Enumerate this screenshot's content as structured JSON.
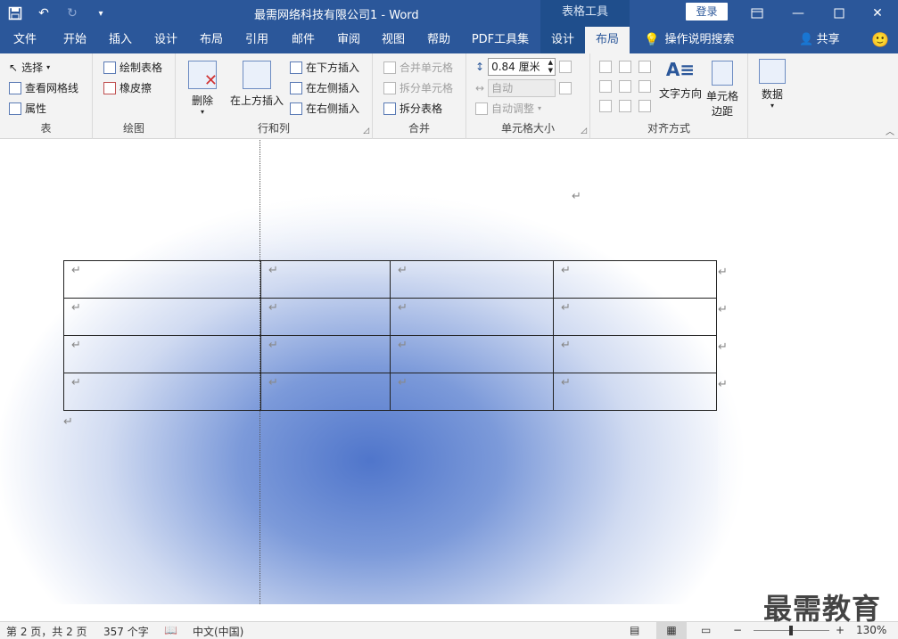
{
  "titlebar": {
    "doc_title": "最需网络科技有限公司1 - Word",
    "context_group": "表格工具",
    "login": "登录"
  },
  "tabs": [
    "文件",
    "开始",
    "插入",
    "设计",
    "布局",
    "引用",
    "邮件",
    "审阅",
    "视图",
    "帮助",
    "PDF工具集",
    "设计",
    "布局"
  ],
  "tell_me": "操作说明搜索",
  "share": "共享",
  "ribbon": {
    "table_group": {
      "label": "表",
      "select": "选择",
      "gridlines": "查看网格线",
      "properties": "属性"
    },
    "draw_group": {
      "label": "绘图",
      "draw_table": "绘制表格",
      "eraser": "橡皮擦"
    },
    "rows_cols": {
      "label": "行和列",
      "delete": "删除",
      "insert_above": "在上方插入",
      "insert_below": "在下方插入",
      "insert_left": "在左侧插入",
      "insert_right": "在右侧插入"
    },
    "merge": {
      "label": "合并",
      "merge_cells": "合并单元格",
      "split_cells": "拆分单元格",
      "split_table": "拆分表格"
    },
    "cell_size": {
      "label": "单元格大小",
      "height_value": "0.84 厘米",
      "width_value": "自动",
      "autofit": "自动调整"
    },
    "alignment": {
      "label": "对齐方式",
      "text_direction": "文字方向",
      "cell_margins_line1": "单元格",
      "cell_margins_line2": "边距"
    },
    "data": {
      "label": "数据"
    }
  },
  "document": {
    "para_mark": "↵",
    "table_rows": 4,
    "table_cols": 4
  },
  "status": {
    "page": "第 2 页，共 2 页",
    "words": "357 个字",
    "language": "中文(中国)",
    "zoom": "130%"
  },
  "watermark": "最需教育"
}
